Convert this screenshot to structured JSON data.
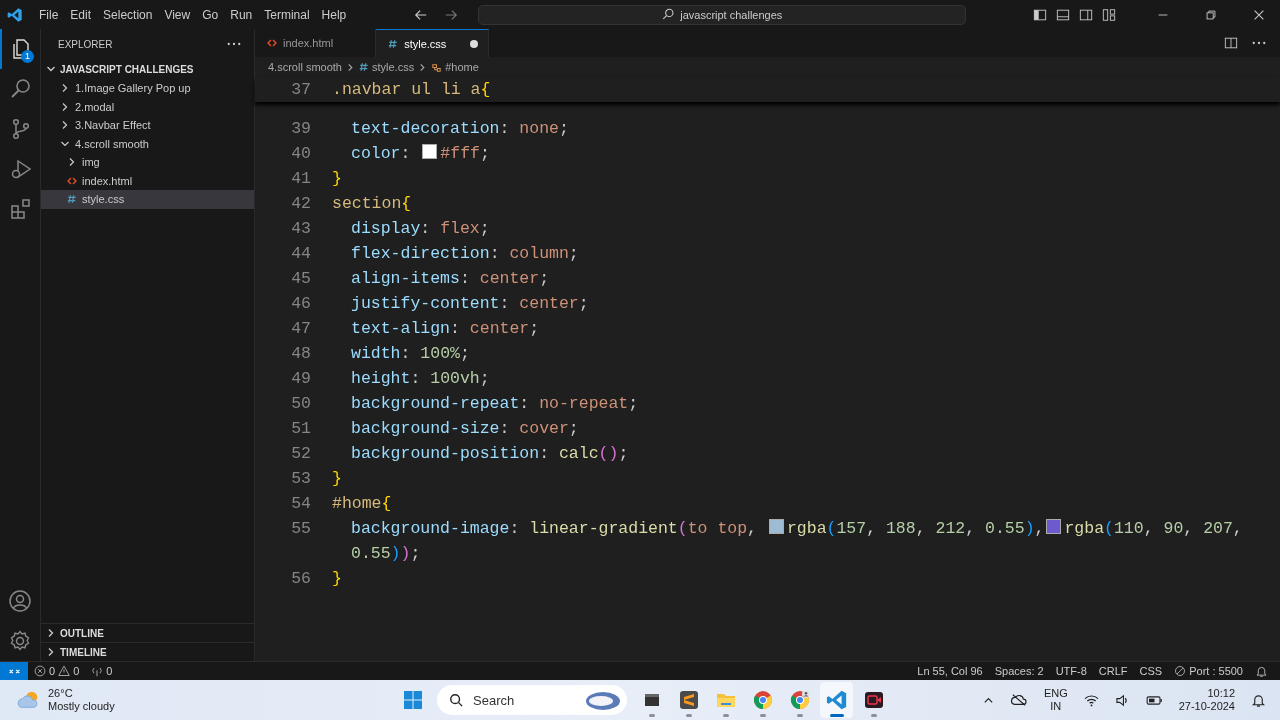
{
  "title_bar": {
    "menu": [
      "File",
      "Edit",
      "Selection",
      "View",
      "Go",
      "Run",
      "Terminal",
      "Help"
    ],
    "search": "javascript challenges"
  },
  "activity_bar": {
    "items": [
      {
        "kind": "explorer",
        "selected": true,
        "badge": "1"
      },
      {
        "kind": "search",
        "selected": false
      },
      {
        "kind": "git",
        "selected": false
      },
      {
        "kind": "debug",
        "selected": false
      },
      {
        "kind": "extensions",
        "selected": false
      }
    ]
  },
  "sidebar": {
    "title": "EXPLORER",
    "folder": "JAVASCRIPT CHALLENGES",
    "tree": [
      {
        "label": "1.Image Gallery Pop up",
        "kind": "folder",
        "expanded": false,
        "selected": false
      },
      {
        "label": "2.modal",
        "kind": "folder",
        "expanded": false,
        "selected": false
      },
      {
        "label": "3.Navbar Effect",
        "kind": "folder",
        "expanded": false,
        "selected": false
      },
      {
        "label": "4.scroll smooth",
        "kind": "folder",
        "expanded": true,
        "selected": false,
        "children": [
          {
            "label": "img",
            "kind": "folder",
            "expanded": false,
            "selected": false
          },
          {
            "label": "index.html",
            "kind": "html",
            "selected": false
          },
          {
            "label": "style.css",
            "kind": "css",
            "selected": true
          }
        ]
      }
    ],
    "sections": [
      {
        "label": "OUTLINE",
        "expanded": false
      },
      {
        "label": "TIMELINE",
        "expanded": false
      }
    ]
  },
  "tabs": [
    {
      "label": "index.html",
      "kind": "html",
      "selected": false,
      "modified": false
    },
    {
      "label": "style.css",
      "kind": "css",
      "selected": true,
      "modified": true
    }
  ],
  "breadcrumb": [
    {
      "label": "4.scroll smooth",
      "kind": "folder"
    },
    {
      "label": "style.css",
      "kind": "css"
    },
    {
      "label": "#home",
      "kind": "symbol"
    }
  ],
  "editor": {
    "sticky": {
      "number": "37",
      "tokens": [
        {
          "kind": "sel",
          "text": ".navbar ul li a"
        },
        {
          "kind": "b1",
          "text": "{"
        }
      ]
    },
    "lines": [
      {
        "number": "39",
        "tokens": [
          {
            "kind": "prop",
            "text": "text-decoration"
          },
          {
            "kind": "p",
            "text": ": "
          },
          {
            "kind": "val",
            "text": "none"
          },
          {
            "kind": "p",
            "text": ";"
          }
        ]
      },
      {
        "number": "40",
        "tokens": [
          {
            "kind": "prop",
            "text": "color"
          },
          {
            "kind": "p",
            "text": ": "
          },
          {
            "kind": "sw",
            "color": "#ffffff"
          },
          {
            "kind": "val",
            "text": "#fff"
          },
          {
            "kind": "p",
            "text": ";"
          }
        ]
      },
      {
        "number": "41",
        "tokens": [
          {
            "kind": "b1",
            "text": "}"
          }
        ]
      },
      {
        "number": "42",
        "tokens": [
          {
            "kind": "sel",
            "text": "section"
          },
          {
            "kind": "b1",
            "text": "{"
          }
        ]
      },
      {
        "number": "43",
        "tokens": [
          {
            "kind": "prop",
            "text": "display"
          },
          {
            "kind": "p",
            "text": ": "
          },
          {
            "kind": "val",
            "text": "flex"
          },
          {
            "kind": "p",
            "text": ";"
          }
        ]
      },
      {
        "number": "44",
        "tokens": [
          {
            "kind": "prop",
            "text": "flex-direction"
          },
          {
            "kind": "p",
            "text": ": "
          },
          {
            "kind": "val",
            "text": "column"
          },
          {
            "kind": "p",
            "text": ";"
          }
        ]
      },
      {
        "number": "45",
        "tokens": [
          {
            "kind": "prop",
            "text": "align-items"
          },
          {
            "kind": "p",
            "text": ": "
          },
          {
            "kind": "val",
            "text": "center"
          },
          {
            "kind": "p",
            "text": ";"
          }
        ]
      },
      {
        "number": "46",
        "tokens": [
          {
            "kind": "prop",
            "text": "justify-content"
          },
          {
            "kind": "p",
            "text": ": "
          },
          {
            "kind": "val",
            "text": "center"
          },
          {
            "kind": "p",
            "text": ";"
          }
        ]
      },
      {
        "number": "47",
        "tokens": [
          {
            "kind": "prop",
            "text": "text-align"
          },
          {
            "kind": "p",
            "text": ": "
          },
          {
            "kind": "val",
            "text": "center"
          },
          {
            "kind": "p",
            "text": ";"
          }
        ]
      },
      {
        "number": "48",
        "tokens": [
          {
            "kind": "prop",
            "text": "width"
          },
          {
            "kind": "p",
            "text": ": "
          },
          {
            "kind": "num",
            "text": "100%"
          },
          {
            "kind": "p",
            "text": ";"
          }
        ]
      },
      {
        "number": "49",
        "tokens": [
          {
            "kind": "prop",
            "text": "height"
          },
          {
            "kind": "p",
            "text": ": "
          },
          {
            "kind": "num",
            "text": "100vh"
          },
          {
            "kind": "p",
            "text": ";"
          }
        ]
      },
      {
        "number": "50",
        "tokens": [
          {
            "kind": "prop",
            "text": "background-repeat"
          },
          {
            "kind": "p",
            "text": ": "
          },
          {
            "kind": "val",
            "text": "no-repeat"
          },
          {
            "kind": "p",
            "text": ";"
          }
        ]
      },
      {
        "number": "51",
        "tokens": [
          {
            "kind": "prop",
            "text": "background-size"
          },
          {
            "kind": "p",
            "text": ": "
          },
          {
            "kind": "val",
            "text": "cover"
          },
          {
            "kind": "p",
            "text": ";"
          }
        ]
      },
      {
        "number": "52",
        "tokens": [
          {
            "kind": "prop",
            "text": "background-position"
          },
          {
            "kind": "p",
            "text": ": "
          },
          {
            "kind": "fn",
            "text": "calc"
          },
          {
            "kind": "b2",
            "text": "()"
          },
          {
            "kind": "p",
            "text": ";"
          }
        ]
      },
      {
        "number": "53",
        "tokens": [
          {
            "kind": "b1",
            "text": "}"
          }
        ]
      },
      {
        "number": "54",
        "tokens": [
          {
            "kind": "sel",
            "text": "#home"
          },
          {
            "kind": "b1",
            "text": "{"
          }
        ]
      },
      {
        "number": "55",
        "tokens": [
          {
            "kind": "prop",
            "text": "background-image"
          },
          {
            "kind": "p",
            "text": ": "
          },
          {
            "kind": "fn",
            "text": "linear-gradient"
          },
          {
            "kind": "b2",
            "text": "("
          },
          {
            "kind": "val",
            "text": "to top"
          },
          {
            "kind": "p",
            "text": ", "
          },
          {
            "kind": "sw",
            "color": "#9dbcd4"
          },
          {
            "kind": "fn",
            "text": "rgba"
          },
          {
            "kind": "b3",
            "text": "("
          },
          {
            "kind": "num",
            "text": "157"
          },
          {
            "kind": "p",
            "text": ", "
          },
          {
            "kind": "num",
            "text": "188"
          },
          {
            "kind": "p",
            "text": ", "
          },
          {
            "kind": "num",
            "text": "212"
          },
          {
            "kind": "p",
            "text": ", "
          },
          {
            "kind": "num",
            "text": "0.55"
          },
          {
            "kind": "b3",
            "text": ")"
          },
          {
            "kind": "p",
            "text": ","
          },
          {
            "kind": "sw",
            "color": "#6e5acf"
          },
          {
            "kind": "fn",
            "text": "rgba"
          },
          {
            "kind": "b3",
            "text": "("
          },
          {
            "kind": "num",
            "text": "110"
          },
          {
            "kind": "p",
            "text": ", "
          },
          {
            "kind": "num",
            "text": "90"
          },
          {
            "kind": "p",
            "text": ", "
          },
          {
            "kind": "num",
            "text": "207"
          },
          {
            "kind": "p",
            "text": ","
          }
        ],
        "continuation": [
          {
            "kind": "num",
            "text": "0.55"
          },
          {
            "kind": "b3",
            "text": ")"
          },
          {
            "kind": "b2",
            "text": ")"
          },
          {
            "kind": "p",
            "text": ";"
          }
        ]
      },
      {
        "number": "56",
        "tokens": [
          {
            "kind": "b1",
            "text": "}"
          }
        ]
      }
    ]
  },
  "status_bar": {
    "errors": "0",
    "warnings": "0",
    "ports": "0",
    "items": [
      "Ln 55, Col 96",
      "Spaces: 2",
      "UTF-8",
      "CRLF",
      "CSS",
      "Port : 5500"
    ]
  },
  "taskbar": {
    "weather": {
      "temp": "26°C",
      "desc": "Mostly cloudy"
    },
    "search": "Search",
    "apps": [
      {
        "kind": "start",
        "active": false
      },
      {
        "kind": "files",
        "active": false
      },
      {
        "kind": "sublime",
        "active": false
      },
      {
        "kind": "folder",
        "active": false
      },
      {
        "kind": "chrome",
        "active": false
      },
      {
        "kind": "chrome-profile",
        "active": false
      },
      {
        "kind": "vscode",
        "active": true
      },
      {
        "kind": "recorder",
        "active": false
      }
    ],
    "lang": [
      "ENG",
      "IN"
    ],
    "time": "10:12",
    "date": "27-10-2024"
  }
}
